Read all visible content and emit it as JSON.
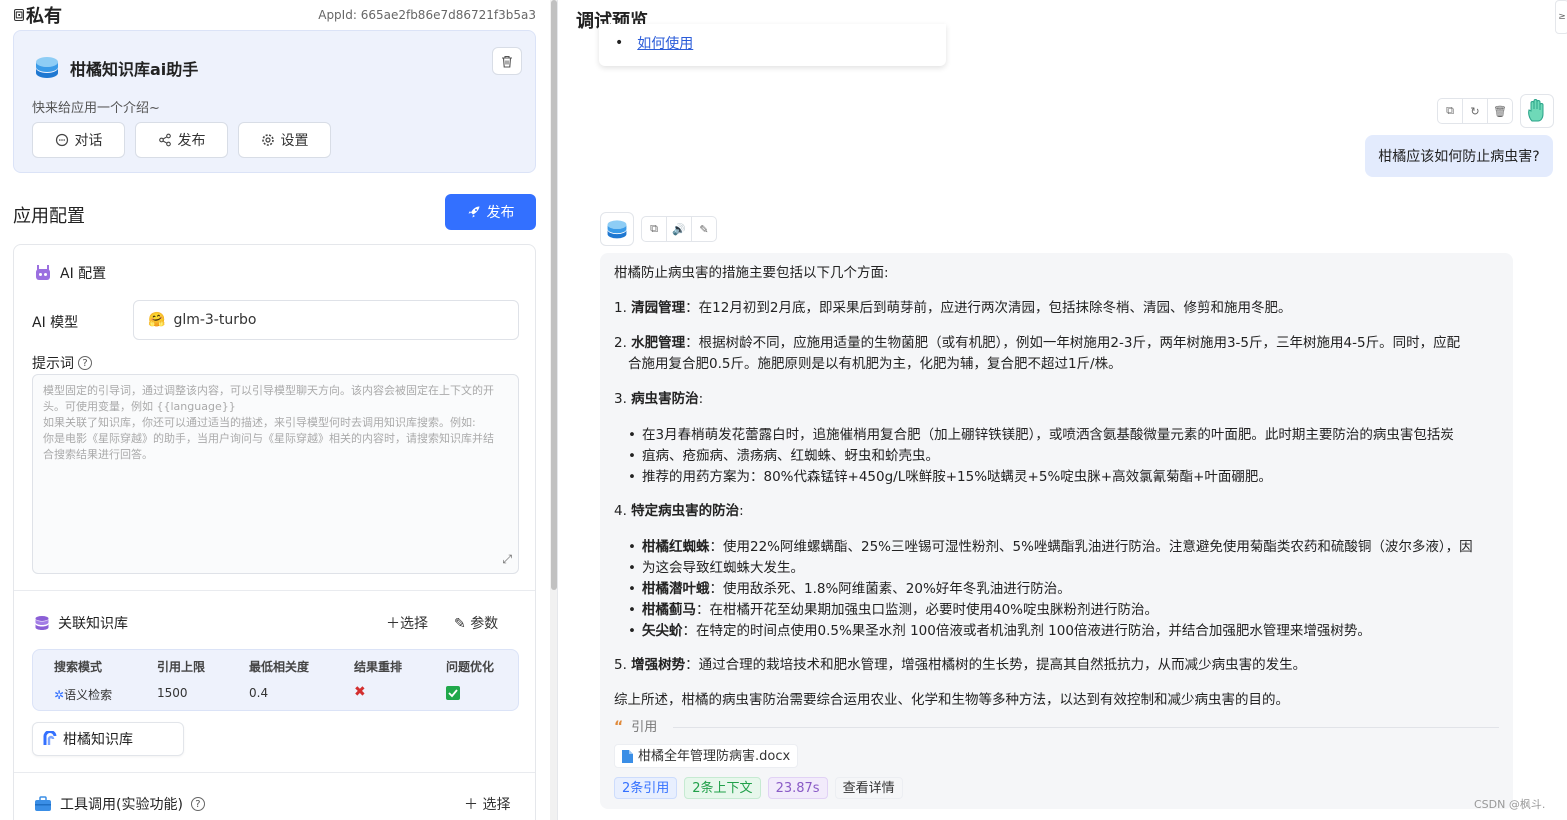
{
  "left": {
    "space_label": "私有",
    "appid": "AppId: 665ae2fb86e7d86721f3b5a3",
    "app_name": "柑橘知识库ai助手",
    "app_intro": "快来给应用一个介绍~",
    "buttons": {
      "chat": "对话",
      "publish": "发布",
      "settings": "设置"
    },
    "config_title": "应用配置",
    "publish_main": "发布",
    "ai": {
      "section": "AI 配置",
      "model_label": "AI 模型",
      "model_value": "glm-3-turbo",
      "prompt_label": "提示词",
      "prompt_placeholder_lines": [
        "模型固定的引导词，通过调整该内容，可以引导模型聊天方向。该内容会被固定在上下文的开",
        "头。可使用变量，例如 {{language}}",
        "如果关联了知识库，你还可以通过适当的描述，来引导模型何时去调用知识库搜索。例如:",
        "你是电影《星际穿越》的助手，当用户询问与《星际穿越》相关的内容时，请搜索知识库并结",
        "合搜索结果进行回答。"
      ]
    },
    "kb": {
      "section": "关联知识库",
      "select": "选择",
      "params": "参数",
      "headers": [
        "搜索模式",
        "引用上限",
        "最低相关度",
        "结果重排",
        "问题优化"
      ],
      "values": {
        "mode": "语义检索",
        "limit": "1500",
        "min_relevance": "0.4"
      },
      "item": "柑橘知识库"
    },
    "tools": {
      "section": "工具调用(实验功能)",
      "select": "选择"
    }
  },
  "right": {
    "title": "调试预览",
    "prev_link": "如何使用",
    "user_message": "柑橘应该如何防止病虫害?",
    "answer": {
      "intro": "柑橘防止病虫害的措施主要包括以下几个方面:",
      "item1_title": "清园管理",
      "item1_text": "：在12月初到2月底，即采果后到萌芽前，应进行两次清园，包括抹除冬梢、清园、修剪和施用冬肥。",
      "item2_title": "水肥管理",
      "item2_text_a": "：根据树龄不同，应施用适量的生物菌肥（或有机肥），例如一年树施用2-3斤，两年树施用3-5斤，三年树施用4-5斤。同时，应配",
      "item2_text_b": "合施用复合肥0.5斤。施肥原则是以有机肥为主，化肥为辅，复合肥不超过1斤/株。",
      "item3_title": "病虫害防治",
      "item3_b1_a": "在3月春梢萌发花蕾露白时，追施催梢用复合肥（加上硼锌铁镁肥），或喷洒含氨基酸微量元素的叶面肥。此时期主要防治的病虫害包括炭",
      "item3_b1_b": "疽病、疮痂病、溃疡病、红蜘蛛、蚜虫和蚧壳虫。",
      "item3_b2": "推荐的用药方案为：80%代森锰锌+450g/L咪鲜胺+15%哒螨灵+5%啶虫脒+高效氯氰菊酯+叶面硼肥。",
      "item4_title": "特定病虫害的防治",
      "item4_b1_title": "柑橘红蜘蛛",
      "item4_b1_a": "：使用22%阿维螺螨酯、25%三唑锡可湿性粉剂、5%唑螨酯乳油进行防治。注意避免使用菊酯类农药和硫酸铜（波尔多液），因",
      "item4_b1_b": "为这会导致红蜘蛛大发生。",
      "item4_b2_title": "柑橘潜叶蛾",
      "item4_b2_text": "：使用敌杀死、1.8%阿维菌素、20%好年冬乳油进行防治。",
      "item4_b3_title": "柑橘蓟马",
      "item4_b3_text": "：在柑橘开花至幼果期加强虫口监测，必要时使用40%啶虫脒粉剂进行防治。",
      "item4_b4_title": "矢尖蚧",
      "item4_b4_text": "：在特定的时间点使用0.5%果圣水剂 100倍液或者机油乳剂 100倍液进行防治，并结合加强肥水管理来增强树势。",
      "item5_title": "增强树势",
      "item5_text": "：通过合理的栽培技术和肥水管理，增强柑橘树的生长势，提高其自然抵抗力，从而减少病虫害的发生。",
      "summary": "综上所述，柑橘的病虫害防治需要综合运用农业、化学和生物等多种方法，以达到有效控制和减少病虫害的目的。"
    },
    "cite_label": "引用",
    "cite_file": "柑橘全年管理防病害.docx",
    "tags": {
      "quotes": "2条引用",
      "context": "2条上下文",
      "time": "23.87s",
      "details": "查看详情"
    }
  },
  "watermark": "CSDN @枫斗.",
  "colors": {
    "primary": "#3370ff",
    "bubble": "#e3ebfd",
    "answer_bg": "#f5f6f8"
  }
}
